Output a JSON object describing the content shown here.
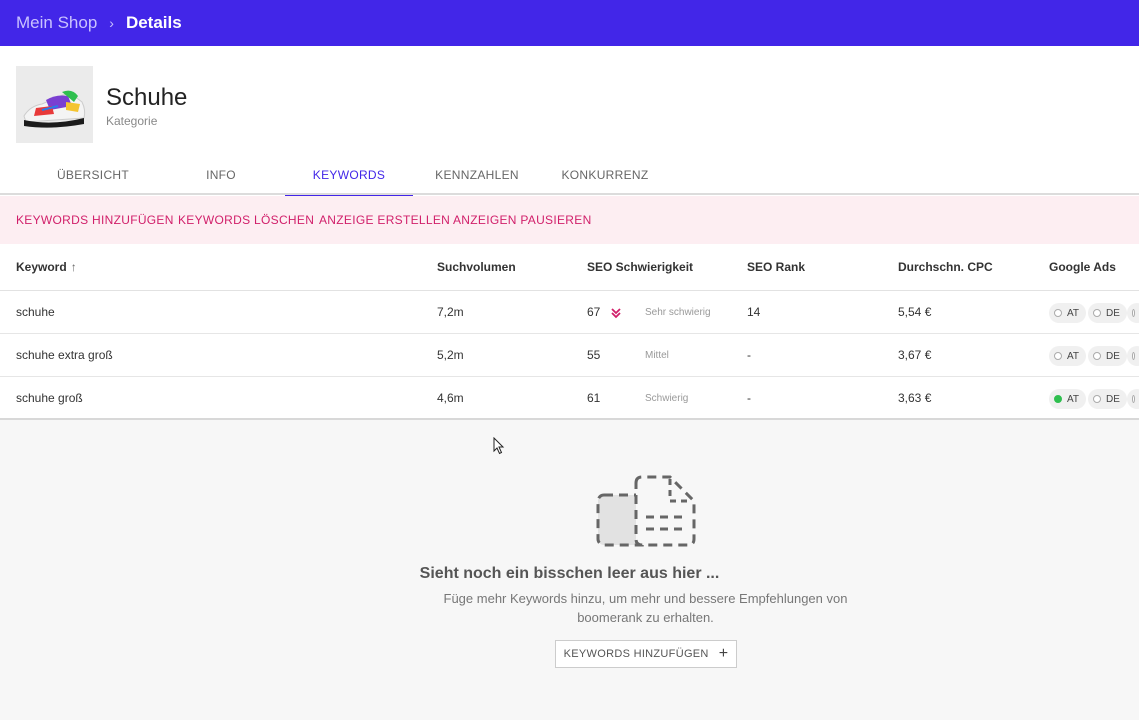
{
  "breadcrumb": {
    "root": "Mein Shop",
    "separator": "›",
    "current": "Details"
  },
  "product": {
    "title": "Schuhe",
    "subtitle": "Kategorie"
  },
  "tabs": [
    {
      "label": "ÜBERSICHT"
    },
    {
      "label": "INFO"
    },
    {
      "label": "KEYWORDS",
      "active": true
    },
    {
      "label": "KENNZAHLEN"
    },
    {
      "label": "KONKURRENZ"
    }
  ],
  "actions": [
    {
      "label": "KEYWORDS HINZUFÜGEN"
    },
    {
      "label": "KEYWORDS LÖSCHEN"
    },
    {
      "label": "ANZEIGE ERSTELLEN"
    },
    {
      "label": "ANZEIGEN PAUSIEREN"
    }
  ],
  "table": {
    "headers": {
      "keyword": "Keyword",
      "sort_icon": "↑",
      "volume": "Suchvolumen",
      "difficulty": "SEO Schwierigkeit",
      "rank": "SEO Rank",
      "cpc": "Durchschn. CPC",
      "ads": "Google Ads"
    },
    "rows": [
      {
        "keyword": "schuhe",
        "volume": "7,2m",
        "difficulty": "67",
        "difficulty_label": "Sehr schwierig",
        "rank": "14",
        "cpc": "5,54 €",
        "ads": [
          {
            "label": "AT",
            "active": false
          },
          {
            "label": "DE",
            "active": false
          }
        ]
      },
      {
        "keyword": "schuhe extra groß",
        "volume": "5,2m",
        "difficulty": "55",
        "difficulty_label": "Mittel",
        "rank": "-",
        "cpc": "3,67 €",
        "ads": [
          {
            "label": "AT",
            "active": false
          },
          {
            "label": "DE",
            "active": false
          }
        ]
      },
      {
        "keyword": "schuhe groß",
        "volume": "4,6m",
        "difficulty": "61",
        "difficulty_label": "Schwierig",
        "rank": "-",
        "cpc": "3,63 €",
        "ads": [
          {
            "label": "AT",
            "active": true
          },
          {
            "label": "DE",
            "active": false
          }
        ]
      }
    ]
  },
  "empty_state": {
    "title": "Sieht noch ein bisschen leer aus hier ...",
    "text": "Füge mehr Keywords hinzu, um mehr und bessere Empfehlungen von boomerank zu erhalten.",
    "button": "KEYWORDS HINZUFÜGEN",
    "button_icon": "+"
  },
  "colors": {
    "primary": "#4226e8",
    "accent": "#d11f6a",
    "active_dot": "#2fbf4f"
  }
}
